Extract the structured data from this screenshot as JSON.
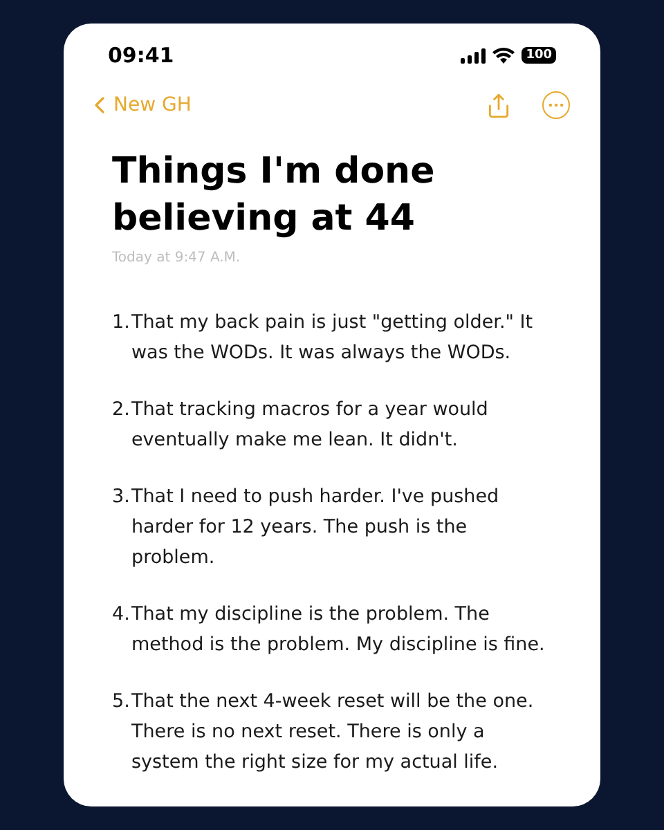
{
  "status_bar": {
    "time": "09:41",
    "battery": "100"
  },
  "nav": {
    "back_label": "New GH"
  },
  "note": {
    "title": "Things I'm done believing at 44",
    "timestamp": "Today at 9:47 A.M.",
    "items": [
      {
        "number": "1.",
        "text": "That my back pain is just \"getting older.\" It was the WODs. It was always the WODs."
      },
      {
        "number": "2.",
        "text": "That tracking macros for a year would eventually make me lean. It didn't."
      },
      {
        "number": "3.",
        "text": "That I need to push harder. I've pushed harder for 12 years. The push is the problem."
      },
      {
        "number": "4.",
        "text": "That my discipline is the problem. The method is the problem. My discipline is fine."
      },
      {
        "number": "5.",
        "text": "That the next 4-week reset will be the one. There is no next reset. There is only a system the right size for my actual life."
      }
    ]
  }
}
